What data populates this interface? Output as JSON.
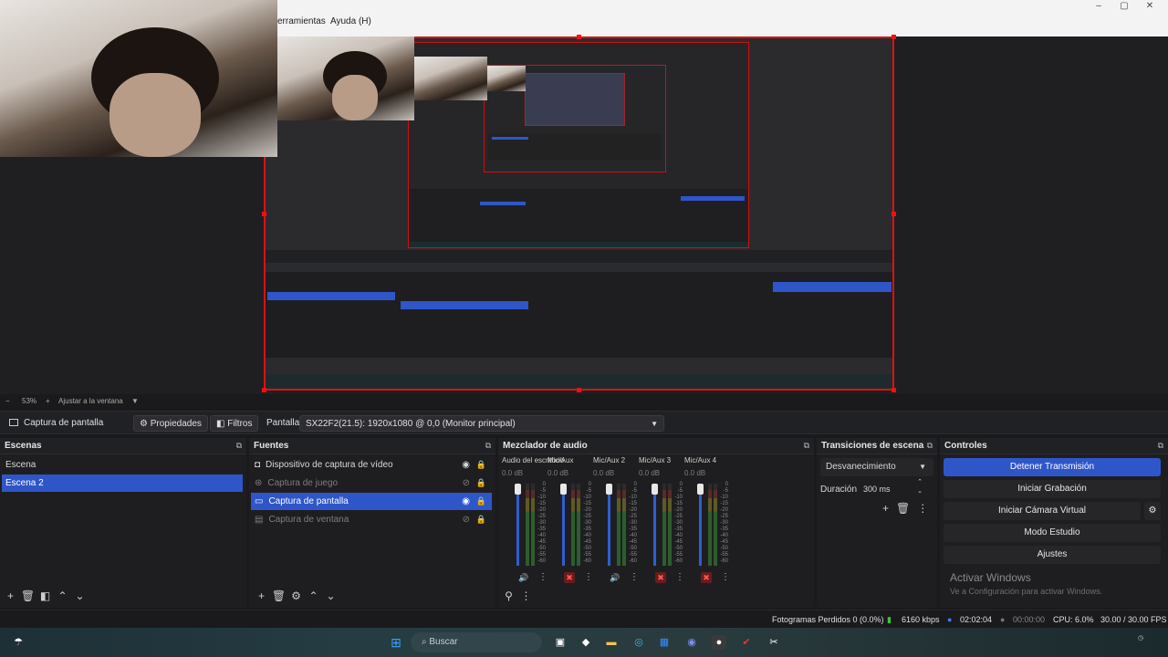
{
  "menu": {
    "tools": "erramientas",
    "help": "Ayuda (H)"
  },
  "window_controls": {
    "minimize": "‒",
    "maximize": "▢",
    "close": "✕"
  },
  "zoombar": {
    "zoom": "53%",
    "fit": "Ajustar a la ventana"
  },
  "source_toolbar": {
    "source_name": "Captura de pantalla",
    "properties": "Propiedades",
    "filters": "Filtros",
    "display_label": "Pantalla",
    "display_value": "SX22F2(21.5): 1920x1080 @ 0,0 (Monitor principal)"
  },
  "scenes": {
    "title": "Escenas",
    "items": [
      {
        "label": "Escena",
        "selected": false
      },
      {
        "label": "Escena 2",
        "selected": true
      }
    ]
  },
  "sources": {
    "title": "Fuentes",
    "items": [
      {
        "label": "Dispositivo de captura de vídeo",
        "icon": "camera-icon",
        "visible": true,
        "selected": false
      },
      {
        "label": "Captura de juego",
        "icon": "gamepad-icon",
        "visible": false,
        "selected": false
      },
      {
        "label": "Captura de pantalla",
        "icon": "monitor-icon",
        "visible": true,
        "selected": true
      },
      {
        "label": "Captura de ventana",
        "icon": "window-icon",
        "visible": false,
        "selected": false
      }
    ]
  },
  "mixer": {
    "title": "Mezclador de audio",
    "channels": [
      {
        "name": "Audio del escritorio",
        "db": "0.0 dB",
        "muted": false
      },
      {
        "name": "Mic/Aux",
        "db": "0.0 dB",
        "muted": true
      },
      {
        "name": "Mic/Aux 2",
        "db": "0.0 dB",
        "muted": false
      },
      {
        "name": "Mic/Aux 3",
        "db": "0.0 dB",
        "muted": true
      },
      {
        "name": "Mic/Aux 4",
        "db": "0.0 dB",
        "muted": true
      }
    ],
    "scale": [
      "0",
      "-5",
      "-10",
      "-15",
      "-20",
      "-25",
      "-30",
      "-35",
      "-40",
      "-45",
      "-50",
      "-55",
      "-60"
    ]
  },
  "transitions": {
    "title": "Transiciones de escena",
    "selected": "Desvanecimiento",
    "duration_label": "Duración",
    "duration_value": "300 ms"
  },
  "controls": {
    "title": "Controles",
    "buttons": [
      "Detener Transmisión",
      "Iniciar Grabación",
      "Iniciar Cámara Virtual",
      "Modo Estudio",
      "Ajustes"
    ]
  },
  "activate_windows": {
    "title": "Activar Windows",
    "subtitle": "Ve a Configuración para activar Windows."
  },
  "status": {
    "dropped": "Fotogramas Perdidos 0 (0.0%)",
    "bitrate": "6160 kbps",
    "stream_time": "02:02:04",
    "rec_time": "00:00:00",
    "cpu": "CPU: 6.0%",
    "fps": "30.00 / 30.00 FPS"
  },
  "taskbar": {
    "search_placeholder": "Buscar"
  },
  "colors": {
    "accent": "#2f56c9",
    "selection_border": "#dd1111",
    "live_green": "#3ec43e"
  }
}
